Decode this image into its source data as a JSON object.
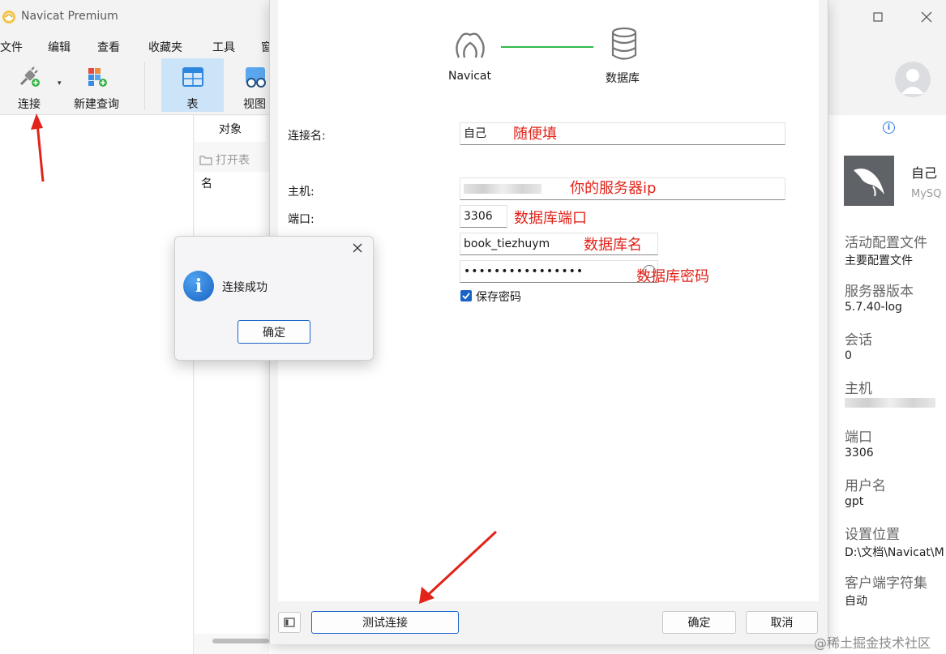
{
  "app": {
    "title": "Navicat Premium"
  },
  "menu": [
    "文件",
    "编辑",
    "查看",
    "收藏夹",
    "工具",
    "窗"
  ],
  "toolbar": {
    "connect": "连接",
    "new_query": "新建查询",
    "table": "表",
    "view": "视图"
  },
  "object_tab": "对象",
  "open_table": "打开表",
  "name_column": "名",
  "wizard": {
    "source": "Navicat",
    "target": "数据库"
  },
  "form": {
    "conn_name_label": "连接名:",
    "conn_name_value": "自己",
    "host_label": "主机:",
    "port_label": "端口:",
    "port_value": "3306",
    "user_value": "book_tiezhuym",
    "password_value": "••••••••••••••••",
    "save_password": "保存密码"
  },
  "annotations": {
    "conn_name": "随便填",
    "host": "你的服务器ip",
    "port": "数据库端口",
    "user": "数据库名",
    "password": "数据库密码"
  },
  "buttons": {
    "test": "测试连接",
    "ok": "确定",
    "cancel": "取消"
  },
  "message": {
    "text": "连接成功",
    "ok": "确定"
  },
  "info": {
    "conn_name": "自己",
    "conn_type": "MySQ",
    "profile_label": "活动配置文件",
    "profile_value": "主要配置文件",
    "server_version_label": "服务器版本",
    "server_version_value": "5.7.40-log",
    "session_label": "会话",
    "session_value": "0",
    "host_label": "主机",
    "port_label": "端口",
    "port_value": "3306",
    "user_label": "用户名",
    "user_value": "gpt",
    "location_label": "设置位置",
    "location_value": "D:\\文档\\Navicat\\M",
    "charset_label": "客户端字符集",
    "charset_value": "自动"
  },
  "watermark": "@稀土掘金技术社区",
  "colors": {
    "accent": "#1a64c8",
    "annotation": "#e2231a",
    "wizard_line": "#2fb84a",
    "selected_tool": "#cce4f7"
  },
  "icons": {
    "app": "navicat-icon",
    "connect": "plug-icon",
    "new_query": "new-query-icon",
    "table": "table-icon",
    "view": "view-icon",
    "folder": "folder-icon",
    "wizard_source": "navicat-logo-icon",
    "wizard_target": "database-icon",
    "info": "info-icon",
    "mysql": "mysql-dolphin-icon",
    "message": "information-icon",
    "close": "close-icon",
    "panel": "panel-toggle-icon"
  }
}
